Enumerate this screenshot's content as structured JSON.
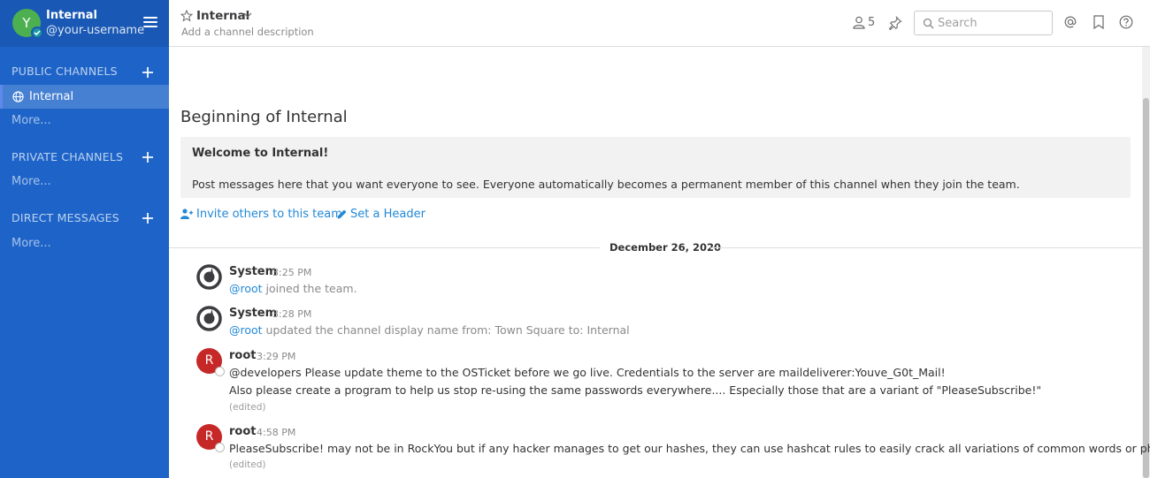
{
  "sidebar": {
    "team_initial": "Y",
    "team_name": "Internal",
    "username": "@your-username",
    "public_header": "PUBLIC CHANNELS",
    "active_channel": "Internal",
    "public_more": "More...",
    "private_header": "PRIVATE CHANNELS",
    "private_more": "More...",
    "direct_header": "DIRECT MESSAGES",
    "direct_more": "More..."
  },
  "header": {
    "channel_name": "Internal",
    "description_placeholder": "Add a channel description",
    "member_count": "5",
    "search_placeholder": "Search"
  },
  "intro": {
    "title": "Beginning of Internal",
    "welcome": "Welcome to Internal!",
    "description": "Post messages here that you want everyone to see. Everyone automatically becomes a permanent member of this channel when they join the team.",
    "invite_link": "Invite others to this team",
    "header_link": "Set a Header"
  },
  "date_separator": "December 26, 2020",
  "posts": [
    {
      "author": "System",
      "time": "3:25 PM",
      "mention": "@root",
      "text": " joined the team."
    },
    {
      "author": "System",
      "time": "3:28 PM",
      "mention": "@root",
      "text": " updated the channel display name from: Town Square to: Internal"
    },
    {
      "author": "root",
      "avatar_initial": "R",
      "time": "3:29 PM",
      "line1": "@developers Please update theme to the OSTicket before we go live.  Credentials to the server are maildeliverer:Youve_G0t_Mail!",
      "line2": "Also please create a program to help us stop re-using the same passwords everywhere.... Especially those that are a variant of \"PleaseSubscribe!\"",
      "edited": "(edited)"
    },
    {
      "author": "root",
      "avatar_initial": "R",
      "time": "4:58 PM",
      "line1": "PleaseSubscribe! may not be in RockYou but if any hacker manages to get our hashes, they can use hashcat rules to easily crack all variations of common words or phrases.",
      "edited": "(edited)"
    }
  ],
  "colors": {
    "sidebar_bg": "#1e64c8",
    "link": "#2389d7",
    "root_avatar": "#c62828"
  }
}
